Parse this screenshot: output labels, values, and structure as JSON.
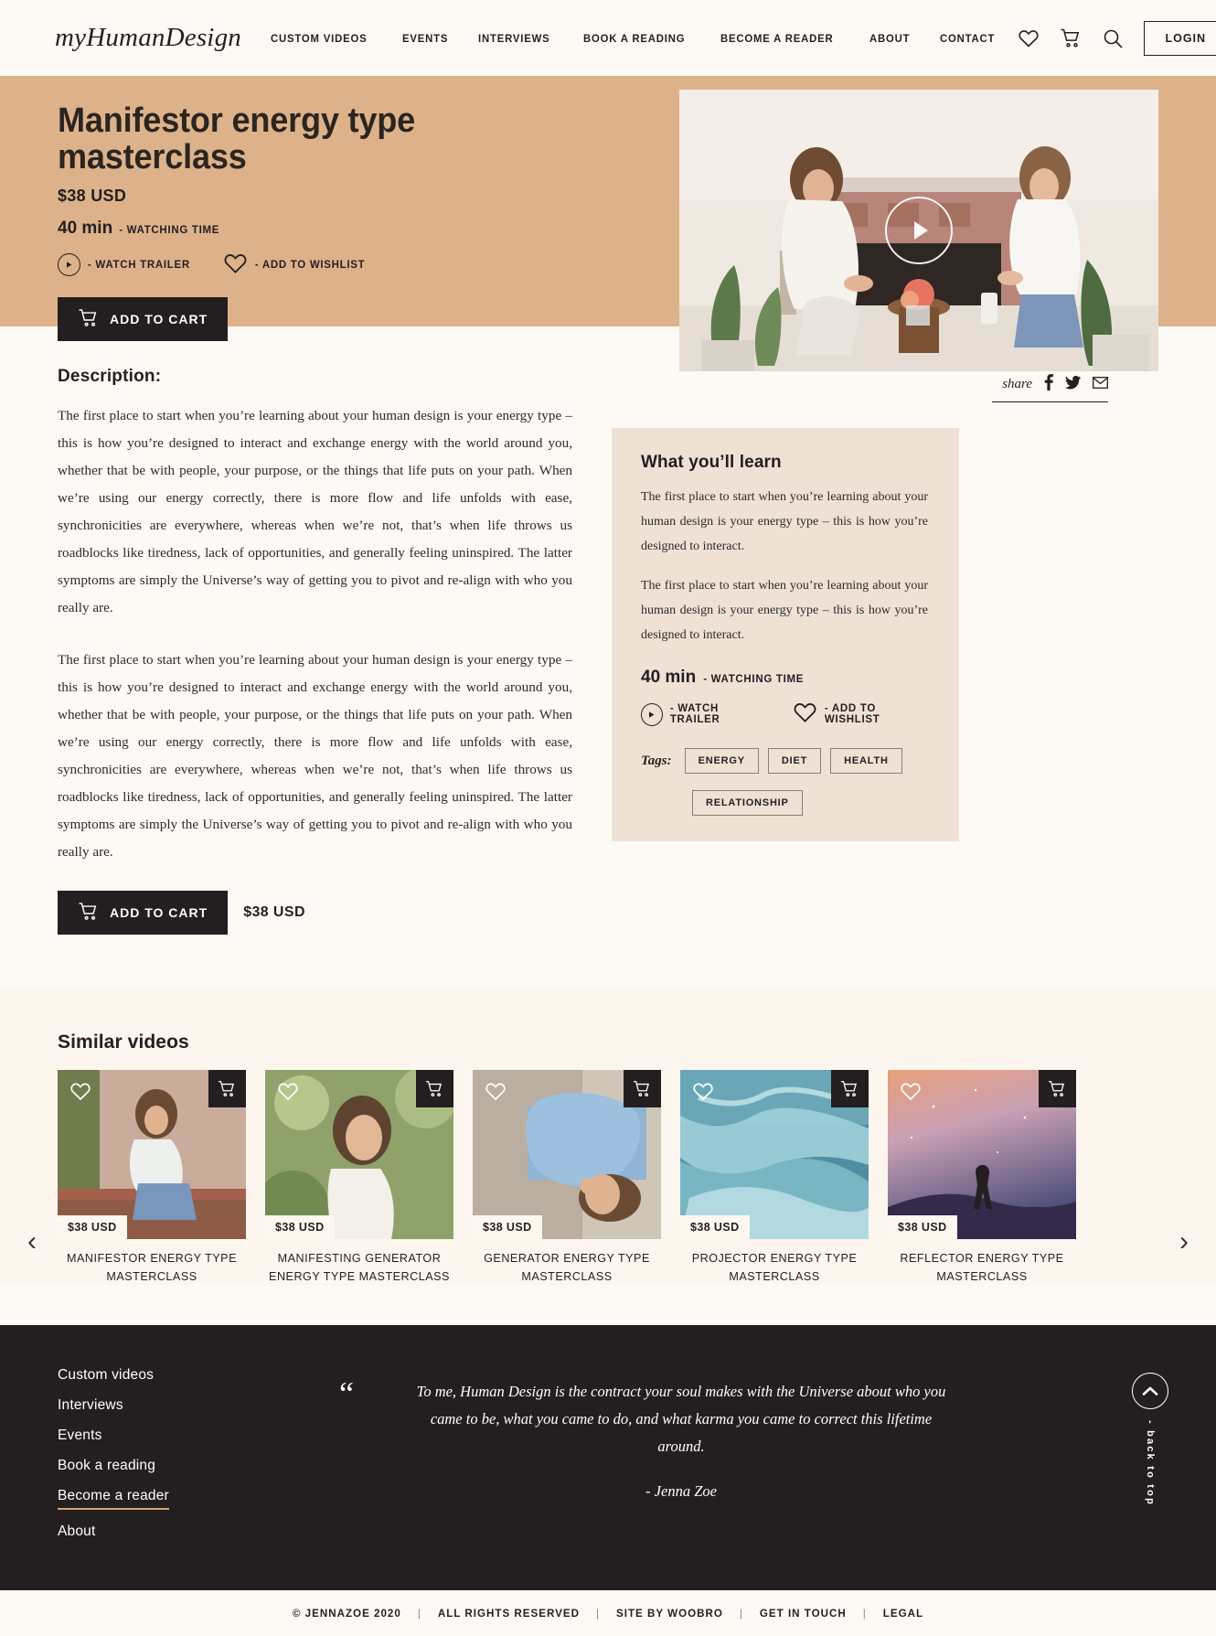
{
  "header": {
    "logo_pre": "my",
    "logo_mid": "Human",
    "logo_post": "Design",
    "nav": [
      {
        "label": "CUSTOM VIDEOS"
      },
      {
        "label": "EVENTS"
      },
      {
        "label": "INTERVIEWS"
      },
      {
        "label": "BOOK A READING"
      },
      {
        "label": "BECOME A READER"
      },
      {
        "label": "ABOUT"
      },
      {
        "label": "CONTACT"
      }
    ],
    "icons": [
      "heart-icon",
      "cart-icon",
      "search-icon"
    ],
    "login_label": "LOGIN"
  },
  "hero": {
    "title": "Manifestor energy type masterclass",
    "price": "$38 USD",
    "duration": "40 min",
    "duration_label": "- WATCHING TIME",
    "watch_trailer": "- WATCH TRAILER",
    "add_wishlist": "- ADD TO WISHLIST",
    "add_to_cart": "ADD TO CART"
  },
  "description": {
    "heading": "Description:",
    "paragraphs": [
      "The first place to start when you’re learning about your human design is your energy type – this is how you’re designed to interact and exchange energy with the world around you, whether that be with people, your purpose, or the things that life puts on your path. When we’re using our energy correctly, there is more flow and life unfolds with ease, synchronicities are everywhere, whereas when we’re not, that’s when life throws us roadblocks like tiredness, lack of opportunities, and generally feeling uninspired. The latter symptoms are simply the Universe’s way of getting you to pivot and re-align with who you really are.",
      "The first place to start when you’re learning about your human design is your energy type – this is how you’re designed to interact and exchange energy with the world around you, whether that be with people, your purpose, or the things that life puts on your path. When we’re using our energy correctly, there is more flow and life unfolds with ease, synchronicities are everywhere, whereas when we’re not, that’s when life throws us roadblocks like tiredness, lack of opportunities, and generally feeling uninspired. The latter symptoms are simply the Universe’s way of getting you to pivot and re-align with who you really are."
    ],
    "cart_label": "ADD TO CART",
    "price": "$38 USD"
  },
  "share": {
    "label": "share",
    "networks": [
      "facebook-icon",
      "twitter-icon",
      "email-icon"
    ]
  },
  "learn": {
    "title": "What you’ll learn",
    "paragraphs": [
      "The first place to start when you’re learning about your human design is your energy type – this is how you’re designed to interact.",
      "The first place to start when you’re learning about your human design is your energy type – this is how you’re designed to interact."
    ],
    "duration": "40 min",
    "duration_label": "- WATCHING TIME",
    "watch_trailer": "- WATCH TRAILER",
    "add_wishlist": "- ADD TO WISHLIST",
    "tags_label": "Tags:",
    "tags": [
      "ENERGY",
      "DIET",
      "HEALTH",
      "RELATIONSHIP"
    ]
  },
  "similar": {
    "heading": "Similar videos",
    "prev": "‹",
    "next": "›",
    "cards": [
      {
        "price": "$38 USD",
        "title": "MANIFESTOR ENERGY TYPE MASTERCLASS",
        "img": "woman-sitting-wall"
      },
      {
        "price": "$38 USD",
        "title": "MANIFESTING GENERATOR ENERGY TYPE MASTERCLASS",
        "img": "woman-looking-down"
      },
      {
        "price": "$38 USD",
        "title": "GENERATOR ENERGY TYPE MASTERCLASS",
        "img": "woman-lying-sand"
      },
      {
        "price": "$38 USD",
        "title": "PROJECTOR ENERGY TYPE MASTERCLASS",
        "img": "ocean-waves"
      },
      {
        "price": "$38 USD",
        "title": "REFLECTOR ENERGY TYPE MASTERCLASS",
        "img": "night-sky-silhouette"
      }
    ]
  },
  "footer": {
    "nav": [
      {
        "label": "Custom videos",
        "active": false
      },
      {
        "label": "Interviews",
        "active": false
      },
      {
        "label": "Events",
        "active": false
      },
      {
        "label": "Book a reading",
        "active": false
      },
      {
        "label": "Become a reader",
        "active": true
      },
      {
        "label": "About",
        "active": false
      }
    ],
    "quote": "To me, Human Design is the contract your soul makes with the Universe about who you came to be, what you came to do, and what karma you came to correct this lifetime around.",
    "quote_author": "- Jenna Zoe",
    "back_to_top": "- back to top",
    "bottom": {
      "copyright": "© JENNAZOE 2020",
      "rights": "ALL RIGHTS RESERVED",
      "site_by": "SITE BY WOOBRO",
      "contact": "GET IN TOUCH",
      "legal": "LEGAL",
      "separator": "|"
    }
  },
  "colors": {
    "page_bg": "#fdfaf5",
    "hero_band": "#ddb28a",
    "panel": "#efe1d4",
    "dark": "#231f20",
    "accent_underline": "#d1a273"
  }
}
